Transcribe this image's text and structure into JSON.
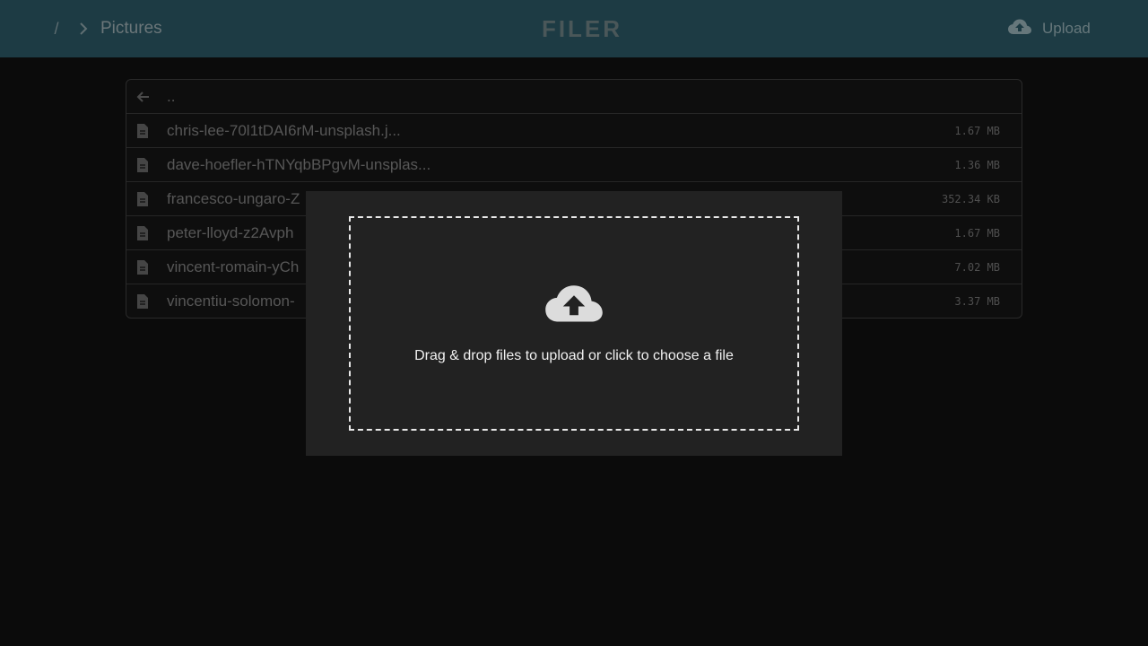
{
  "header": {
    "breadcrumb_root": "/",
    "breadcrumb_current": "Pictures",
    "logo": "FILER",
    "upload_label": "Upload"
  },
  "file_list": {
    "parent_label": "..",
    "files": [
      {
        "name": "chris-lee-70l1tDAI6rM-unsplash.j...",
        "size": "1.67 MB"
      },
      {
        "name": "dave-hoefler-hTNYqbBPgvM-unsplas...",
        "size": "1.36 MB"
      },
      {
        "name": "francesco-ungaro-Z",
        "size": "352.34 KB"
      },
      {
        "name": "peter-lloyd-z2Avph",
        "size": "1.67 MB"
      },
      {
        "name": "vincent-romain-yCh",
        "size": "7.02 MB"
      },
      {
        "name": "vincentiu-solomon-",
        "size": "3.37 MB"
      }
    ]
  },
  "upload_modal": {
    "dropzone_text": "Drag & drop files to upload or click to choose a file"
  },
  "colors": {
    "header_bg": "#1d3b44",
    "page_bg": "#0b0b0b",
    "modal_bg": "#222222"
  },
  "icons": [
    "slash-icon",
    "chevron-right-icon",
    "cloud-upload-icon",
    "arrow-left-icon",
    "file-icon"
  ]
}
